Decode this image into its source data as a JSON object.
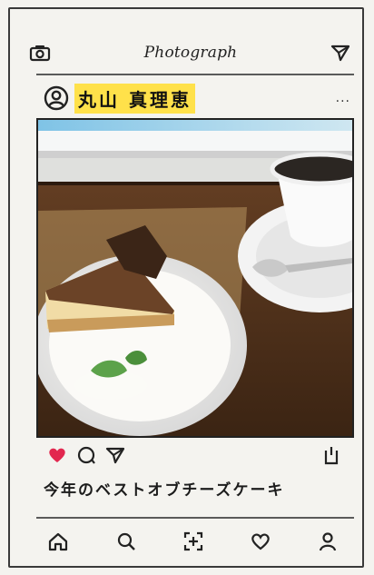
{
  "header": {
    "title": "Photograph",
    "left_icon": "camera-icon",
    "right_icon": "send-icon"
  },
  "post": {
    "username": "丸山 真理恵",
    "more_label": "...",
    "photo_alt": "cheesecake-and-coffee-photo",
    "caption": "今年のベストオブチーズケーキ",
    "highlight_color": "#ffe14a",
    "like_color": "#e2274f"
  },
  "actions": [
    "heart-icon",
    "comment-icon",
    "share-icon",
    "save-icon"
  ],
  "nav": [
    "home-icon",
    "search-icon",
    "add-post-icon",
    "activity-icon",
    "profile-icon"
  ]
}
